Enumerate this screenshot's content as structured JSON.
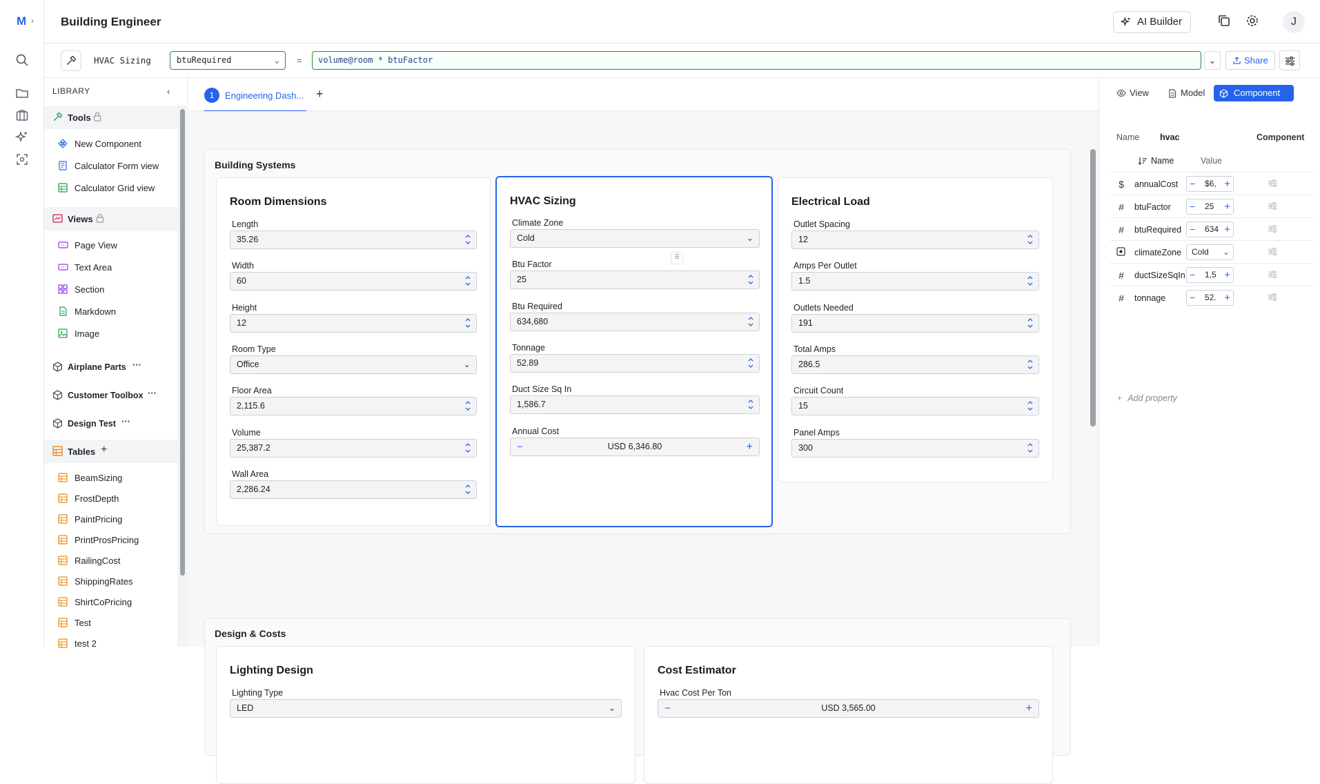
{
  "app": {
    "logo": "M",
    "title": "Building Engineer",
    "ai_builder": "AI Builder",
    "avatar": "J"
  },
  "formula": {
    "name": "HVAC Sizing",
    "selected_field": "btuRequired",
    "equals": "=",
    "expression": "volume@room * btuFactor",
    "share": "Share"
  },
  "library": {
    "heading": "LIBRARY",
    "groups": {
      "tools": {
        "label": "Tools",
        "items": [
          "New Component",
          "Calculator Form view",
          "Calculator Grid view"
        ]
      },
      "views": {
        "label": "Views",
        "items": [
          "Page View",
          "Text Area",
          "Section",
          "Markdown",
          "Image"
        ]
      },
      "others": [
        "Airplane Parts",
        "Customer Toolbox",
        "Design Test"
      ],
      "tables": {
        "label": "Tables",
        "items": [
          "BeamSizing",
          "FrostDepth",
          "PaintPricing",
          "PrintProsPricing",
          "RailingCost",
          "ShippingRates",
          "ShirtCoPricing",
          "Test",
          "test 2"
        ]
      }
    }
  },
  "tabs": [
    {
      "number": "1",
      "label": "Engineering Dash..."
    }
  ],
  "sections": [
    {
      "title": "Building Systems",
      "cards": [
        {
          "title": "Room Dimensions",
          "fields": [
            {
              "label": "Length",
              "value": "35.26",
              "type": "number"
            },
            {
              "label": "Width",
              "value": "60",
              "type": "number"
            },
            {
              "label": "Height",
              "value": "12",
              "type": "number"
            },
            {
              "label": "Room Type",
              "value": "Office",
              "type": "select"
            },
            {
              "label": "Floor Area",
              "value": "2,115.6",
              "type": "number"
            },
            {
              "label": "Volume",
              "value": "25,387.2",
              "type": "number"
            },
            {
              "label": "Wall Area",
              "value": "2,286.24",
              "type": "number"
            }
          ]
        },
        {
          "title": "HVAC Sizing",
          "fields": [
            {
              "label": "Climate Zone",
              "value": "Cold",
              "type": "select"
            },
            {
              "label": "Btu Factor",
              "value": "25",
              "type": "number"
            },
            {
              "label": "Btu Required",
              "value": "634,680",
              "type": "number"
            },
            {
              "label": "Tonnage",
              "value": "52.89",
              "type": "number"
            },
            {
              "label": "Duct Size Sq In",
              "value": "1,586.7",
              "type": "number"
            },
            {
              "label": "Annual Cost",
              "value": "USD 6,346.80",
              "type": "currency"
            }
          ]
        },
        {
          "title": "Electrical Load",
          "fields": [
            {
              "label": "Outlet Spacing",
              "value": "12",
              "type": "number"
            },
            {
              "label": "Amps Per Outlet",
              "value": "1.5",
              "type": "number"
            },
            {
              "label": "Outlets Needed",
              "value": "191",
              "type": "number"
            },
            {
              "label": "Total Amps",
              "value": "286.5",
              "type": "number"
            },
            {
              "label": "Circuit Count",
              "value": "15",
              "type": "number"
            },
            {
              "label": "Panel Amps",
              "value": "300",
              "type": "number"
            }
          ]
        }
      ]
    },
    {
      "title": "Design & Costs",
      "cards": [
        {
          "title": "Lighting Design",
          "fields": [
            {
              "label": "Lighting Type",
              "value": "LED",
              "type": "select"
            }
          ]
        },
        {
          "title": "Cost Estimator",
          "fields": [
            {
              "label": "Hvac Cost Per Ton",
              "value": "USD 3,565.00",
              "type": "currency"
            }
          ]
        }
      ]
    }
  ],
  "right_panel": {
    "modes": [
      "View",
      "Model",
      "Component"
    ],
    "active_mode": "Component",
    "name_label": "Name",
    "name_value": "hvac",
    "kind": "Component",
    "col_name": "Name",
    "col_value": "Value",
    "properties": [
      {
        "type": "$",
        "name": "annualCost",
        "value": "$6,"
      },
      {
        "type": "#",
        "name": "btuFactor",
        "value": "25"
      },
      {
        "type": "#",
        "name": "btuRequired",
        "value": "634"
      },
      {
        "type": "sel",
        "name": "climateZone",
        "value": "Cold"
      },
      {
        "type": "#",
        "name": "ductSizeSqIn",
        "value": "1,5"
      },
      {
        "type": "#",
        "name": "tonnage",
        "value": "52."
      }
    ],
    "add_property": "Add property"
  },
  "colors": {
    "accent": "#2563eb",
    "formula_border": "#2b8a3e"
  }
}
